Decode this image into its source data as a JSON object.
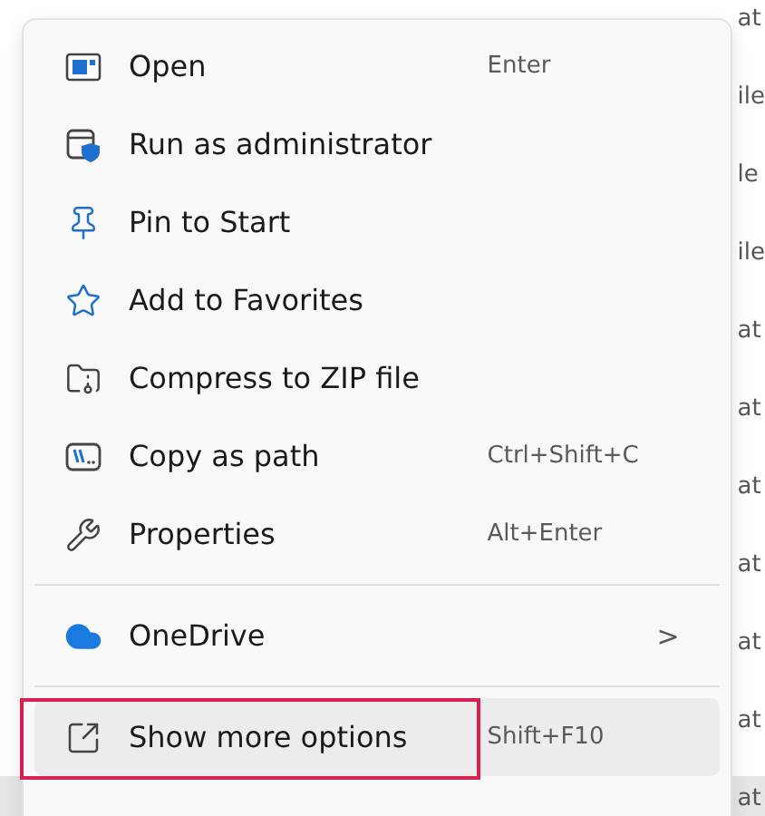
{
  "menu": {
    "items": [
      {
        "kind": "command",
        "label": "Open",
        "shortcut": "Enter",
        "selected": false,
        "outlined": false
      },
      {
        "kind": "command",
        "label": "Run as administrator",
        "selected": false,
        "outlined": false
      },
      {
        "kind": "command",
        "label": "Pin to Start",
        "selected": false,
        "outlined": false
      },
      {
        "kind": "command",
        "label": "Add to Favorites",
        "selected": false,
        "outlined": false
      },
      {
        "kind": "command",
        "label": "Compress to ZIP file",
        "selected": false,
        "outlined": false
      },
      {
        "kind": "command",
        "label": "Copy as path",
        "shortcut": "Ctrl+Shift+C",
        "selected": false,
        "outlined": false
      },
      {
        "kind": "command",
        "label": "Properties",
        "shortcut": "Alt+Enter",
        "selected": false,
        "outlined": false
      },
      {
        "kind": "separator"
      },
      {
        "kind": "submenu",
        "label": "OneDrive",
        "arrow": ">",
        "selected": false,
        "outlined": false
      },
      {
        "kind": "separator"
      },
      {
        "kind": "command",
        "label": "Show more options",
        "shortcut": "Shift+F10",
        "selected": true,
        "outlined": true
      }
    ]
  },
  "background_column": [
    "at",
    "ile",
    "le",
    "ile",
    "at",
    "at",
    "at",
    "at",
    "at",
    "at",
    "at"
  ]
}
